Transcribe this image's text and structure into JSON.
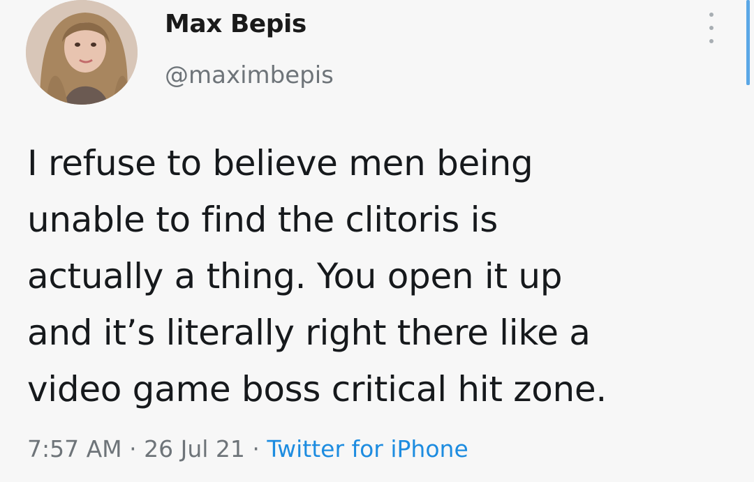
{
  "tweet": {
    "author": {
      "name": "Max Bepis",
      "handle": "@maximbepis",
      "avatar_icon": "profile-photo"
    },
    "text_lines": [
      "I refuse to believe men being",
      "unable to find the clitoris is",
      "actually a thing. You open it up",
      "and it’s literally right there like a",
      "video game boss critical hit zone."
    ],
    "time": "7:57 AM",
    "separator": " · ",
    "date": "26 Jul 21",
    "source": "Twitter for iPhone",
    "more_icon": "more-vertical-icon"
  },
  "colors": {
    "background": "#f7f7f7",
    "text": "#16191c",
    "muted": "#6e7479",
    "link": "#1d8ce0",
    "scrollbar": "#5aa7e6"
  }
}
